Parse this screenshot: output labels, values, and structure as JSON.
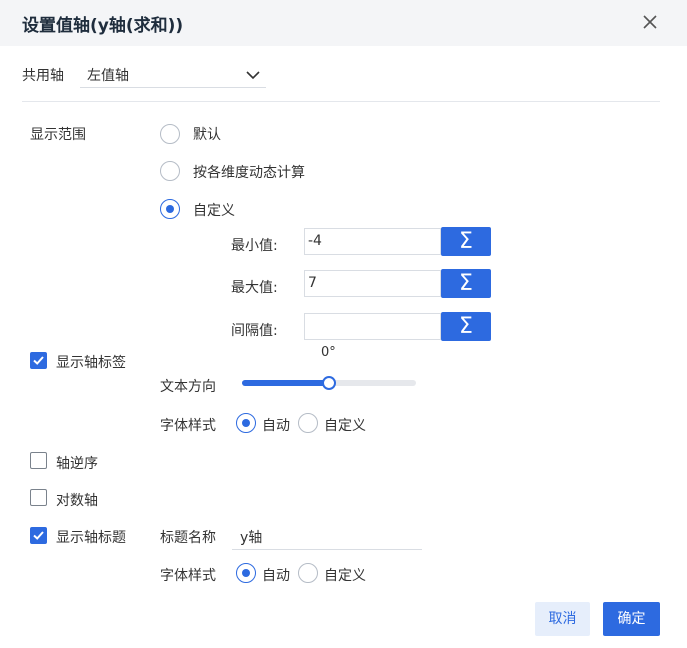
{
  "dialog": {
    "title": "设置值轴(y轴(求和))",
    "close_icon": "close-icon"
  },
  "shared_axis": {
    "label": "共用轴",
    "value": "左值轴"
  },
  "display_range": {
    "label": "显示范围",
    "options": [
      "默认",
      "按各维度动态计算",
      "自定义"
    ],
    "selected": "自定义",
    "min_label": "最小值:",
    "min_value": "-4",
    "max_label": "最大值:",
    "max_value": "7",
    "interval_label": "间隔值:",
    "interval_value": "",
    "sigma_symbol": "Σ"
  },
  "axis_labels": {
    "label": "显示轴标签",
    "checked": true,
    "angle": "0°",
    "angle_fraction": 0.5,
    "text_direction_label": "文本方向",
    "font_style_label": "字体样式",
    "font_options": [
      "自动",
      "自定义"
    ],
    "font_selected": "自动"
  },
  "axis_reverse": {
    "label": "轴逆序",
    "checked": false
  },
  "log_axis": {
    "label": "对数轴",
    "checked": false
  },
  "axis_title": {
    "label": "显示轴标题",
    "checked": true,
    "name_label": "标题名称",
    "name_value": "y轴",
    "font_style_label": "字体样式",
    "font_options": [
      "自动",
      "自定义"
    ],
    "font_selected": "自动"
  },
  "footer": {
    "cancel_label": "取消",
    "confirm_label": "确定"
  },
  "colors": {
    "accent": "#2d6ae0",
    "header_bg": "#f4f5f7",
    "cancel_bg": "#e6eefb"
  }
}
